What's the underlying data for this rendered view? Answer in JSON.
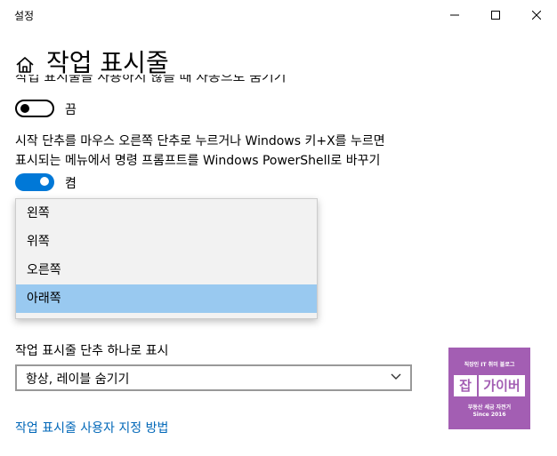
{
  "window": {
    "title": "설정",
    "minimize_icon": "minimize-icon",
    "maximize_icon": "maximize-icon",
    "close_icon": "close-icon"
  },
  "header": {
    "home_icon": "home-icon",
    "title": "작업 표시줄"
  },
  "setting1": {
    "clipped_text": "작업 표시줄을 사용하지 않을 때 자동으로 숨기기",
    "toggle_state": "off",
    "toggle_label": "끔"
  },
  "setting2": {
    "description_line1": "시작 단추를 마우스 오른쪽 단추로 누르거나 Windows 키+X를 누르면",
    "description_line2": "표시되는 메뉴에서 명령 프롬프트를 Windows PowerShell로 바꾸기",
    "toggle_state": "on",
    "toggle_label": "켬"
  },
  "position_dropdown": {
    "options": [
      "왼쪽",
      "위쪽",
      "오른쪽",
      "아래쪽"
    ],
    "selected": "아래쪽"
  },
  "combine_buttons": {
    "label": "작업 표시줄 단추 하나로 표시",
    "value": "항상, 레이블 숨기기",
    "chevron_icon": "chevron-down-icon"
  },
  "help_link": "작업 표시줄 사용자 지정 방법",
  "watermark": {
    "top": "직장인 IT 취미 블로그",
    "main_left": "잡",
    "main_right": "가이버",
    "sub": "부동산 세금 자전거",
    "since": "Since 2016"
  },
  "colors": {
    "accent": "#0078d7",
    "selected_option": "#99c9f0",
    "link": "#0067b8",
    "watermark_bg": "#a35eb3"
  }
}
